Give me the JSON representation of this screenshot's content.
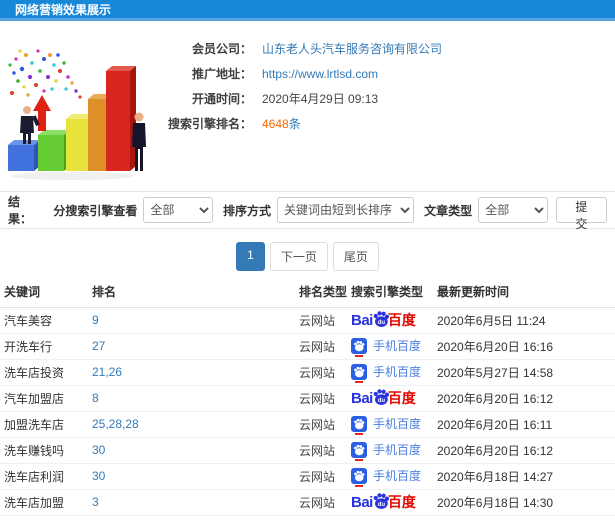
{
  "window": {
    "title": "网络营销效果展示"
  },
  "info": {
    "fields": [
      {
        "label": "会员公司：",
        "value": "山东老人头汽车服务咨询有限公司"
      },
      {
        "label": "推广地址：",
        "value": "https://www.lrtlsd.com"
      },
      {
        "label": "开通时间：",
        "value": "2020年4月29日 09:13"
      },
      {
        "label": "搜索引擎排名：",
        "count": "4648",
        "unit": "条"
      }
    ]
  },
  "filters": {
    "result_label": "结果：",
    "engine_filter_label": "分搜索引擎查看",
    "engine_filter_value": "全部",
    "sort_label": "排序方式",
    "sort_value": "关键词由短到长排序",
    "article_type_label": "文章类型",
    "article_type_value": "全部",
    "submit_label": "提交"
  },
  "pagination": {
    "current_page": "1",
    "next_label": "下一页",
    "last_label": "尾页"
  },
  "table": {
    "headers": [
      "关键词",
      "排名",
      "排名类型",
      "搜索引擎类型",
      "最新更新时间"
    ],
    "rows": [
      {
        "keyword": "汽车美容",
        "rank": "9",
        "rank_type": "云网站",
        "engine": "baidu-pc",
        "updated": "2020年6月5日 11:24"
      },
      {
        "keyword": "开洗车行",
        "rank": "27",
        "rank_type": "云网站",
        "engine": "baidu-mobile",
        "updated": "2020年6月20日 16:16"
      },
      {
        "keyword": "洗车店投资",
        "rank": "21,26",
        "rank_type": "云网站",
        "engine": "baidu-mobile",
        "updated": "2020年5月27日 14:58"
      },
      {
        "keyword": "汽车加盟店",
        "rank": "8",
        "rank_type": "云网站",
        "engine": "baidu-pc",
        "updated": "2020年6月20日 16:12"
      },
      {
        "keyword": "加盟洗车店",
        "rank": "25,28,28",
        "rank_type": "云网站",
        "engine": "baidu-mobile",
        "updated": "2020年6月20日 16:11"
      },
      {
        "keyword": "洗车赚钱吗",
        "rank": "30",
        "rank_type": "云网站",
        "engine": "baidu-mobile",
        "updated": "2020年6月20日 16:12"
      },
      {
        "keyword": "洗车店利润",
        "rank": "30",
        "rank_type": "云网站",
        "engine": "baidu-mobile",
        "updated": "2020年6月18日 14:27"
      },
      {
        "keyword": "洗车店加盟",
        "rank": "3",
        "rank_type": "云网站",
        "engine": "baidu-pc",
        "updated": "2020年6月18日 14:30"
      }
    ]
  },
  "logos": {
    "baidu_pc": {
      "prefix": "Bai",
      "paw_text": "du",
      "suffix": "百度"
    },
    "baidu_mobile": {
      "label": "手机百度"
    }
  },
  "colors": {
    "header_bg": "#1787d8",
    "link_blue": "#337ab7",
    "count_orange": "#ff6600",
    "active_page_bg": "#337ab7",
    "baidu_blue": "#2932e1",
    "baidu_red": "#e10601",
    "mobile_text_blue": "#4a7fe0"
  }
}
